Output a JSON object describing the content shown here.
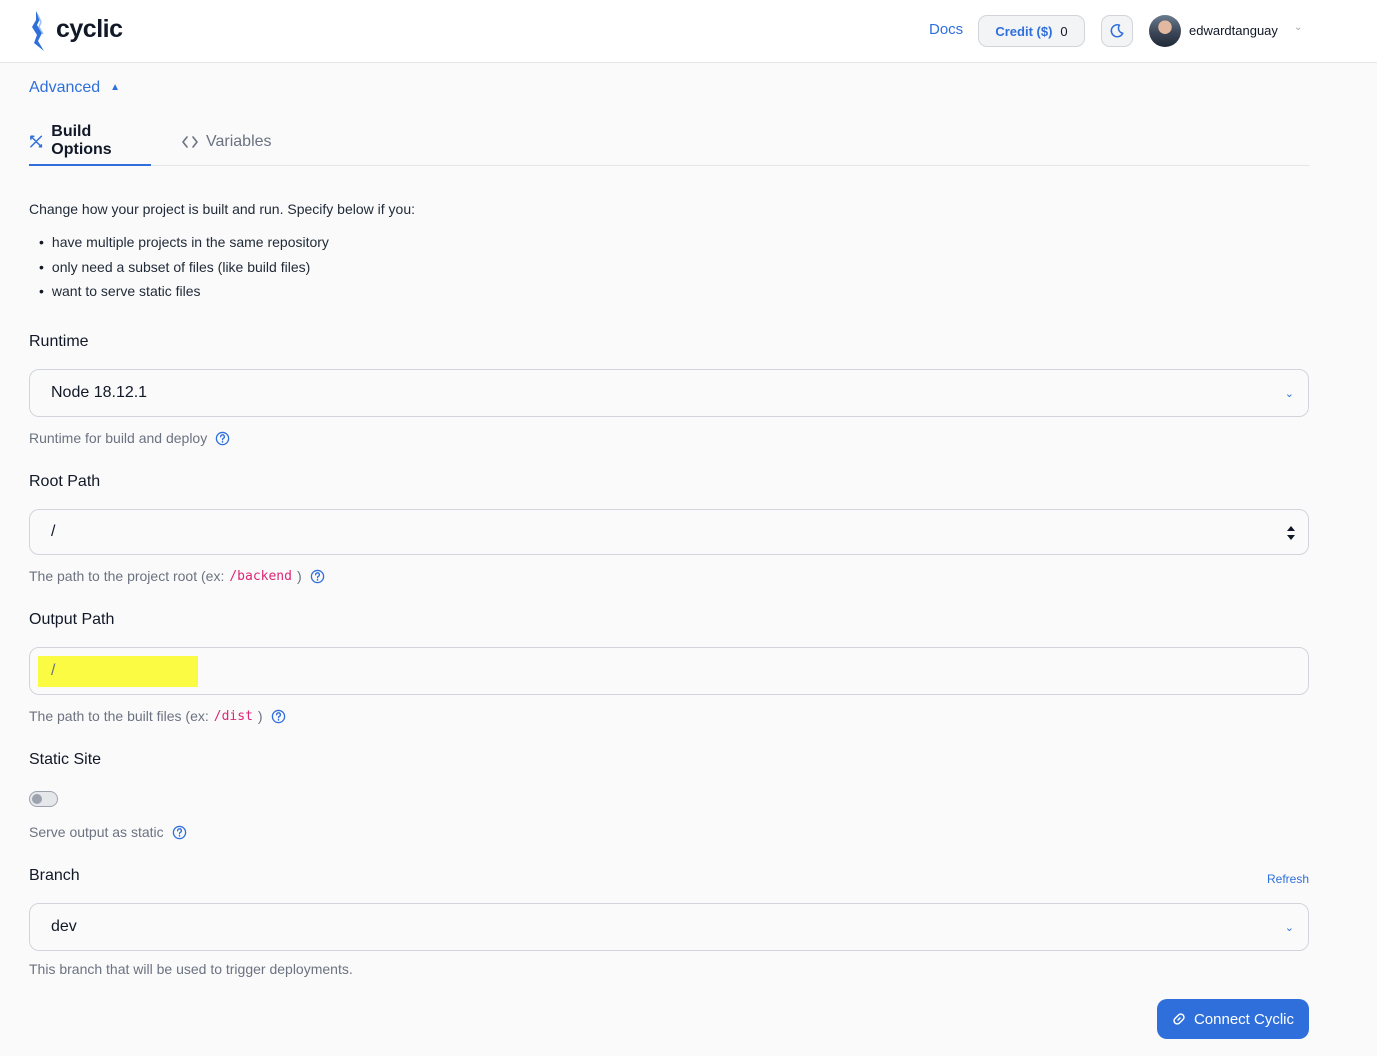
{
  "header": {
    "logo_text": "cyclic",
    "docs_label": "Docs",
    "credit_label": "Credit ($)",
    "credit_value": "0",
    "username": "edwardtanguay"
  },
  "advanced": {
    "label": "Advanced"
  },
  "tabs": [
    {
      "label": "Build Options",
      "active": true
    },
    {
      "label": "Variables",
      "active": false
    }
  ],
  "intro": {
    "text": "Change how your project is built and run. Specify below if you:",
    "bullets": [
      "have multiple projects in the same repository",
      "only need a subset of files (like build files)",
      "want to serve static files"
    ]
  },
  "runtime": {
    "label": "Runtime",
    "value": "Node 18.12.1",
    "hint": "Runtime for build and deploy"
  },
  "root_path": {
    "label": "Root Path",
    "value": "/",
    "hint_prefix": "The path to the project root (ex: ",
    "hint_code": "/backend",
    "hint_suffix": ")"
  },
  "output_path": {
    "label": "Output Path",
    "value": "/",
    "hint_prefix": "The path to the built files (ex: ",
    "hint_code": "/dist",
    "hint_suffix": ")"
  },
  "static_site": {
    "label": "Static Site",
    "enabled": false,
    "hint": "Serve output as static"
  },
  "branch": {
    "label": "Branch",
    "refresh_label": "Refresh",
    "value": "dev",
    "hint": "This branch that will be used to trigger deployments."
  },
  "connect_button": {
    "label": "Connect Cyclic"
  },
  "colors": {
    "accent": "#2f6fdc",
    "highlight": "#fbfb44",
    "code": "#db2777"
  }
}
